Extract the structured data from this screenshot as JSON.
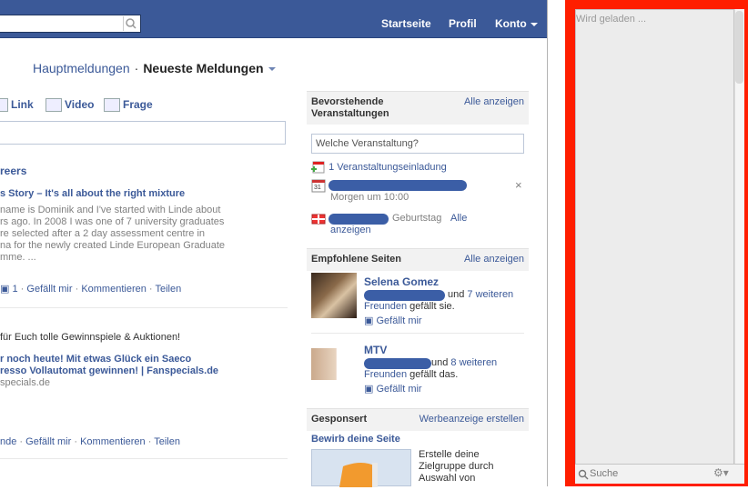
{
  "topbar": {
    "nav_start": "Startseite",
    "nav_profil": "Profil",
    "nav_konto": "Konto",
    "search_icon": "magnifier-icon"
  },
  "feed_tabs": {
    "tab_top": "Hauptmeldungen",
    "separator": "·",
    "tab_recent": "Neueste Meldungen"
  },
  "share": {
    "link": "Link",
    "video": "Video",
    "question": "Frage"
  },
  "posts": [
    {
      "author": "reers",
      "title": "s Story – It's all about the right mixture",
      "lines": [
        "name is Dominik and I've started with Linde about",
        "rs ago. In 2008 I was one of 7 university graduates",
        "re selected after a 2 day assessment centre in",
        "na for the newly created Linde European Graduate",
        "mme. ..."
      ],
      "like_count": "1",
      "actions": [
        "Gefällt mir",
        "Kommentieren",
        "Teilen"
      ],
      "action_sep": "·"
    },
    {
      "lead": "für Euch tolle Gewinnspiele & Auktionen!",
      "title_line1": "r noch heute! Mit etwas Glück ein Saeco",
      "title_line2": "resso Vollautomat gewinnen! | Fanspecials.de",
      "domain": "specials.de",
      "actions_prefix": "nde",
      "actions": [
        "Gefällt mir",
        "Kommentieren",
        "Teilen"
      ],
      "action_sep": "·"
    }
  ],
  "events": {
    "title_line1": "Bevorstehende",
    "title_line2": "Veranstaltungen",
    "see_all": "Alle anzeigen",
    "input_placeholder": "Welche Veranstaltung?",
    "invite": "1 Veranstaltungseinladung",
    "event_time": "Morgen um 10:00",
    "birthday_text": "Geburtstag",
    "birthday_link1": "Alle",
    "birthday_link2": "anzeigen",
    "close": "×",
    "calendar_day": "31"
  },
  "pages": {
    "title": "Empfohlene Seiten",
    "see_all": "Alle anzeigen",
    "items": [
      {
        "name": "Selena Gomez",
        "and": "und",
        "more": "7 weiteren",
        "friends": "Freunden",
        "liked": "gefällt sie.",
        "like": "Gefällt mir"
      },
      {
        "name": "MTV",
        "and": "und",
        "more": "8 weiteren",
        "friends": "Freunden",
        "liked": "gefällt das.",
        "like": "Gefällt mir"
      }
    ]
  },
  "sponsored": {
    "title": "Gesponsert",
    "create": "Werbeanzeige erstellen",
    "ad_title": "Bewirb deine Seite",
    "ad_line1": "Erstelle deine",
    "ad_line2": "Zielgruppe durch",
    "ad_line3": "Auswahl von"
  },
  "chat": {
    "loading": "Wird geladen ...",
    "search": "Suche",
    "gear_icon": "gear-icon"
  },
  "colors": {
    "brand": "#3b5998",
    "highlight": "#ff1e00"
  }
}
